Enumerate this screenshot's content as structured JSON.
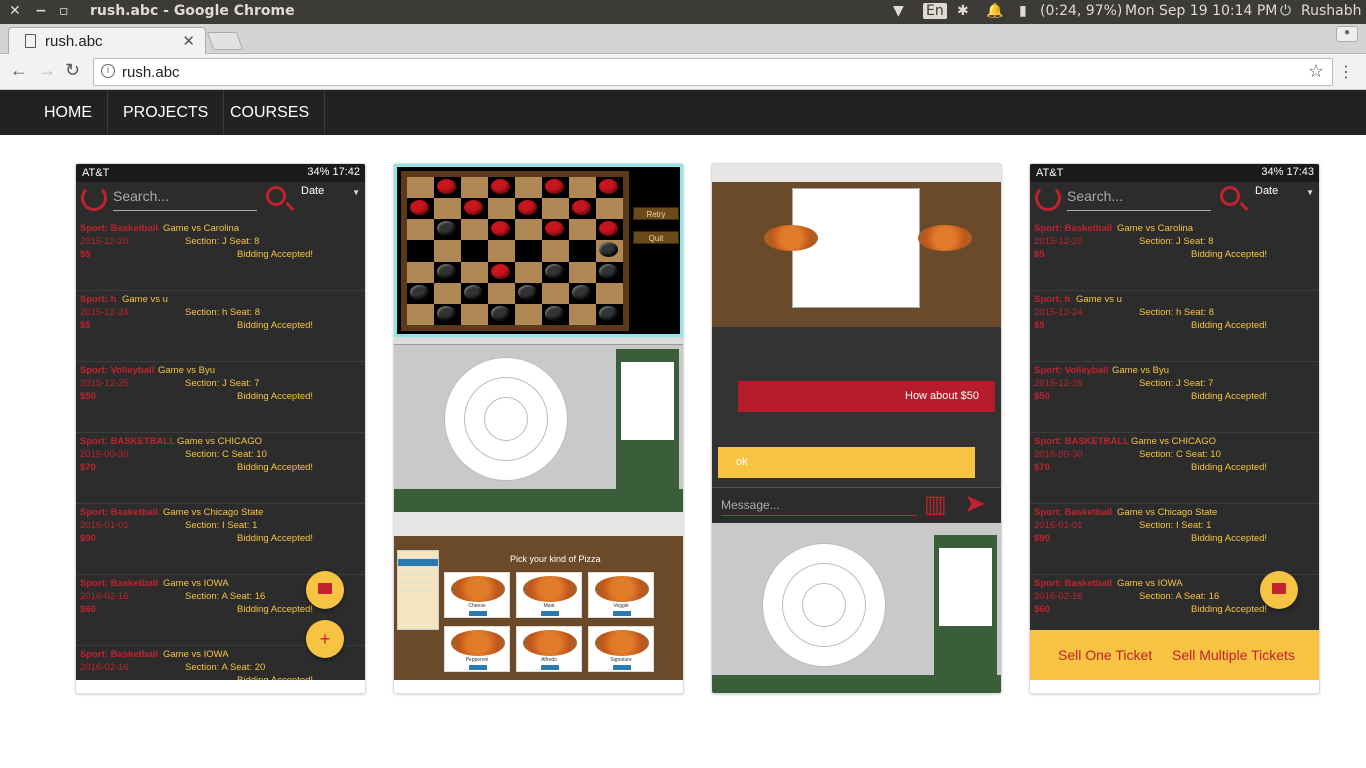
{
  "os": {
    "window_title": "rush.abc - Google Chrome",
    "lang": "En",
    "battery": "(0:24, 97%)",
    "datetime": "Mon Sep 19 10:14 PM",
    "user": "Rushabh"
  },
  "browser": {
    "tab_title": "rush.abc",
    "url": "rush.abc"
  },
  "nav": {
    "items": [
      "HOME",
      "PROJECTS",
      "COURSES"
    ]
  },
  "app": {
    "left_status_carrier": "AT&T",
    "left_status_right": "34% 17:42",
    "right_status_right": "34% 17:43",
    "search_placeholder": "Search...",
    "sort_label": "Date",
    "tickets": [
      {
        "sport": "Sport: Basketball",
        "game": "Game vs Carolina",
        "date": "2015-12-20",
        "section": "Section: J Seat: 8",
        "price": "$5",
        "status": "Bidding Accepted!"
      },
      {
        "sport": "Sport: h",
        "game": "Game vs u",
        "date": "2015-12-24",
        "section": "Section: h Seat: 8",
        "price": "$5",
        "status": "Bidding Accepted!"
      },
      {
        "sport": "Sport: Volleyball",
        "game": "Game vs Byu",
        "date": "2015-12-25",
        "section": "Section: J Seat: 7",
        "price": "$50",
        "status": "Bidding Accepted!"
      },
      {
        "sport": "Sport: BASKETBALL",
        "game": "Game vs CHICAGO",
        "date": "2016-00-30",
        "section": "Section: C Seat: 10",
        "price": "$70",
        "status": "Bidding Accepted!"
      },
      {
        "sport": "Sport: Basketball",
        "game": "Game vs Chicago State",
        "date": "2016-01-01",
        "section": "Section: I Seat: 1",
        "price": "$90",
        "status": "Bidding Accepted!"
      },
      {
        "sport": "Sport: Basketball",
        "game": "Game vs IOWA",
        "date": "2016-02-16",
        "section": "Section: A Seat: 16",
        "price": "$60",
        "status": "Bidding Accepted!"
      },
      {
        "sport": "Sport: Basketball",
        "game": "Game vs IOWA",
        "date": "2016-02-16",
        "section": "Section: A Seat: 20",
        "price": "",
        "status": "Bidding Accepted!"
      }
    ],
    "sell_one": "Sell One Ticket",
    "sell_multiple": "Sell Multiple Tickets"
  },
  "checkers": {
    "retry": "Retry",
    "quit": "Quit"
  },
  "pizza": {
    "heading": "Pick your kind of Pizza",
    "names": [
      "Cheese",
      "Meat",
      "Veggie",
      "Pepperoni",
      "Alfredo",
      "Signature"
    ]
  },
  "chat": {
    "msg_out": "How about $50",
    "msg_in": "ok",
    "input_placeholder": "Message..."
  }
}
